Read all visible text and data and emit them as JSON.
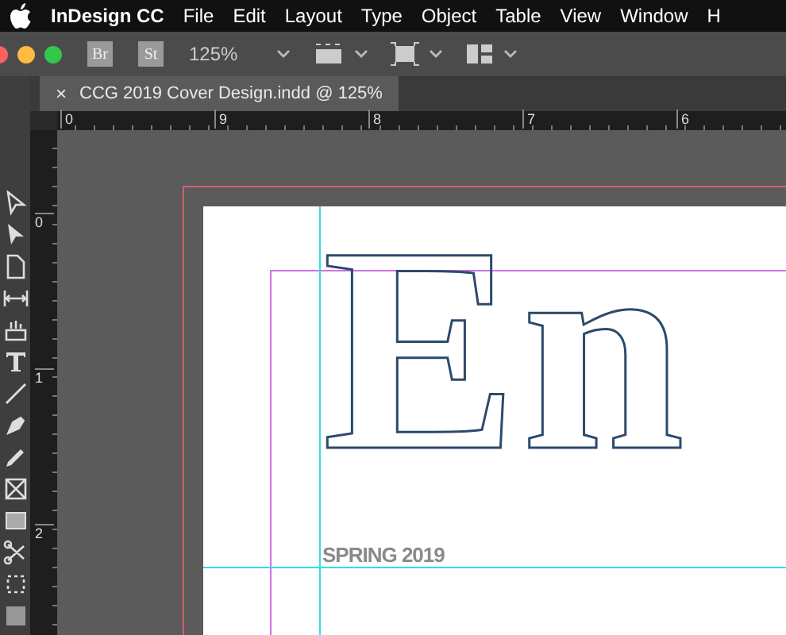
{
  "menu_bar": {
    "app_name": "InDesign CC",
    "items": [
      "File",
      "Edit",
      "Layout",
      "Type",
      "Object",
      "Table",
      "View",
      "Window",
      "H"
    ]
  },
  "control_bar": {
    "buttons": [
      "Br",
      "St"
    ],
    "zoom": "125%"
  },
  "document_tab": {
    "close": "×",
    "title": "CCG 2019 Cover Design.indd @ 125%",
    "selected": true
  },
  "horizontal_ruler": {
    "labels": [
      "0",
      "9",
      "8",
      "7",
      "6"
    ]
  },
  "vertical_ruler": {
    "labels": [
      "0",
      "1",
      "2"
    ]
  },
  "page": {
    "headline": "En",
    "subtitle": "SPRING 2019"
  }
}
